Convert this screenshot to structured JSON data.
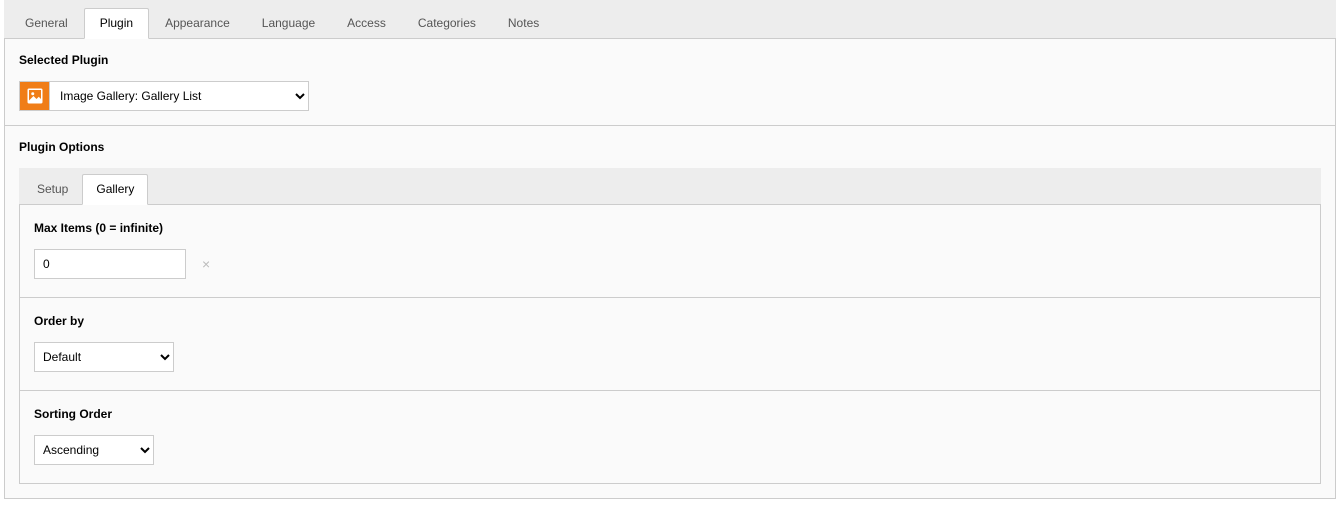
{
  "topTabs": [
    {
      "label": "General",
      "active": false
    },
    {
      "label": "Plugin",
      "active": true
    },
    {
      "label": "Appearance",
      "active": false
    },
    {
      "label": "Language",
      "active": false
    },
    {
      "label": "Access",
      "active": false
    },
    {
      "label": "Categories",
      "active": false
    },
    {
      "label": "Notes",
      "active": false
    }
  ],
  "selectedPlugin": {
    "title": "Selected Plugin",
    "value": "Image Gallery: Gallery List"
  },
  "pluginOptions": {
    "title": "Plugin Options",
    "tabs": [
      {
        "label": "Setup",
        "active": false
      },
      {
        "label": "Gallery",
        "active": true
      }
    ],
    "maxItems": {
      "label": "Max Items (0 = infinite)",
      "value": "0"
    },
    "orderBy": {
      "label": "Order by",
      "value": "Default"
    },
    "sortingOrder": {
      "label": "Sorting Order",
      "value": "Ascending"
    }
  }
}
